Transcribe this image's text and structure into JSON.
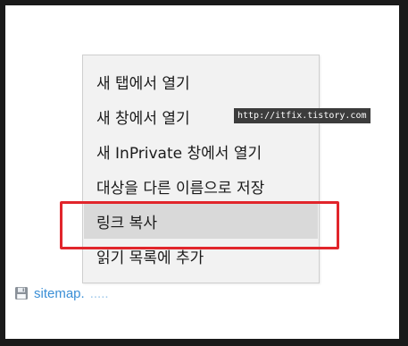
{
  "context_menu": {
    "items": [
      {
        "label": "새 탭에서 열기"
      },
      {
        "label": "새 창에서 열기"
      },
      {
        "label": "새 InPrivate 창에서 열기"
      },
      {
        "label": "대상을 다른 이름으로 저장"
      },
      {
        "label": "링크 복사",
        "state": "hover"
      },
      {
        "label": "읽기 목록에 추가"
      }
    ]
  },
  "page_link": {
    "icon": "floppy-disk-icon",
    "text": "sitemap.",
    "ellipsis": "....."
  },
  "watermark": {
    "text": "http://itfix.tistory.com"
  },
  "colors": {
    "highlight": "#e1252b",
    "menu_background": "#f2f2f2",
    "menu_hover": "#d9d9d9",
    "link": "#3b8fd6"
  }
}
